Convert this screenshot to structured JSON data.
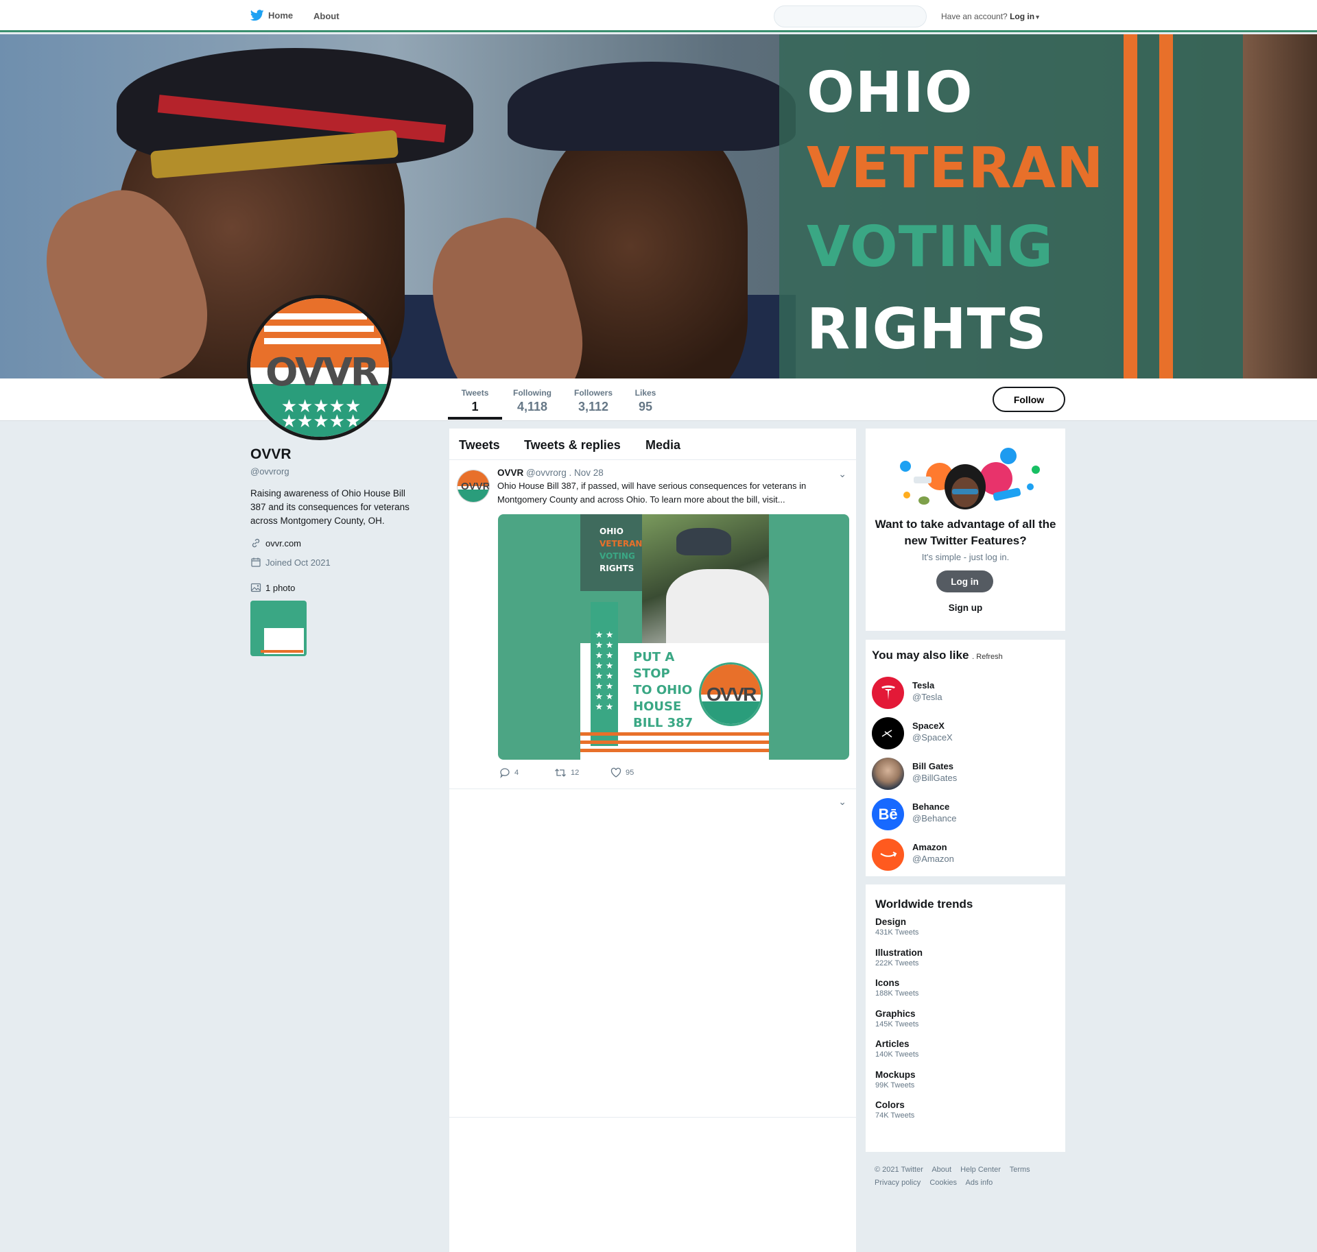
{
  "nav": {
    "home": "Home",
    "about": "About",
    "search_placeholder": "",
    "account_prompt": "Have an account?",
    "login": "Log in"
  },
  "banner": {
    "line1": "OHIO",
    "line2": "VETERAN",
    "line3": "VOTING",
    "line4": "RIGHTS"
  },
  "stats": [
    {
      "label": "Tweets",
      "value": "1"
    },
    {
      "label": "Following",
      "value": "4,118"
    },
    {
      "label": "Followers",
      "value": "3,112"
    },
    {
      "label": "Likes",
      "value": "95"
    }
  ],
  "follow_label": "Follow",
  "profile": {
    "name": "OVVR",
    "handle": "@ovvrorg",
    "bio": "Raising awareness of Ohio House Bill 387 and its consequences for veterans across Montgomery County, OH.",
    "website": "ovvr.com",
    "joined": "Joined Oct 2021",
    "photos": "1 photo",
    "avatar_text": "OVVR"
  },
  "tabs": [
    "Tweets",
    "Tweets & replies",
    "Media"
  ],
  "tweet": {
    "name": "OVVR",
    "handle": "@ovvrorg . Nov 28",
    "text": "Ohio House Bill 387, if passed, will have serious consequences for veterans in Montgomery County and across Ohio. To learn more about the bill, visit...",
    "image": {
      "l1": "OHIO",
      "l2": "VETERAN",
      "l3": "VOTING",
      "l4": "RIGHTS",
      "p1": "PUT A",
      "p2": "STOP",
      "p3": "TO OHIO",
      "p4": "HOUSE",
      "p5": "BILL 387",
      "logo": "OVVR"
    },
    "replies": "4",
    "retweets": "12",
    "likes": "95"
  },
  "promo": {
    "title": "Want to take advantage of all the new Twitter Features?",
    "subtitle": "It's simple - just log in.",
    "login": "Log in",
    "signup": "Sign up"
  },
  "suggest": {
    "heading": "You may also like",
    "refresh": ". Refresh",
    "accounts": [
      {
        "name": "Tesla",
        "handle": "@Tesla",
        "icon": "T",
        "color": "#e31937"
      },
      {
        "name": "SpaceX",
        "handle": "@SpaceX",
        "icon": "X",
        "color": "#000000"
      },
      {
        "name": "Bill Gates",
        "handle": "@BillGates",
        "icon": "",
        "color": "#3b4a5a"
      },
      {
        "name": "Behance",
        "handle": "@Behance",
        "icon": "Bē",
        "color": "#1769ff"
      },
      {
        "name": "Amazon",
        "handle": "@Amazon",
        "icon": "a",
        "color": "#ff5a1f"
      }
    ]
  },
  "trends": {
    "heading": "Worldwide trends",
    "items": [
      {
        "name": "Design",
        "count": "431K Tweets"
      },
      {
        "name": "Illustration",
        "count": "222K Tweets"
      },
      {
        "name": "Icons",
        "count": "188K Tweets"
      },
      {
        "name": "Graphics",
        "count": "145K Tweets"
      },
      {
        "name": "Articles",
        "count": "140K Tweets"
      },
      {
        "name": "Mockups",
        "count": "99K Tweets"
      },
      {
        "name": "Colors",
        "count": "74K Tweets"
      }
    ]
  },
  "footer": {
    "copyright": "© 2021 Twitter",
    "about": "About",
    "help": "Help Center",
    "terms": "Terms",
    "privacy": "Privacy policy",
    "cookies": "Cookies",
    "ads": "Ads info"
  },
  "colors": {
    "orange": "#e8702a",
    "green": "#3aa784",
    "twitter_blue": "#1da1f2"
  }
}
